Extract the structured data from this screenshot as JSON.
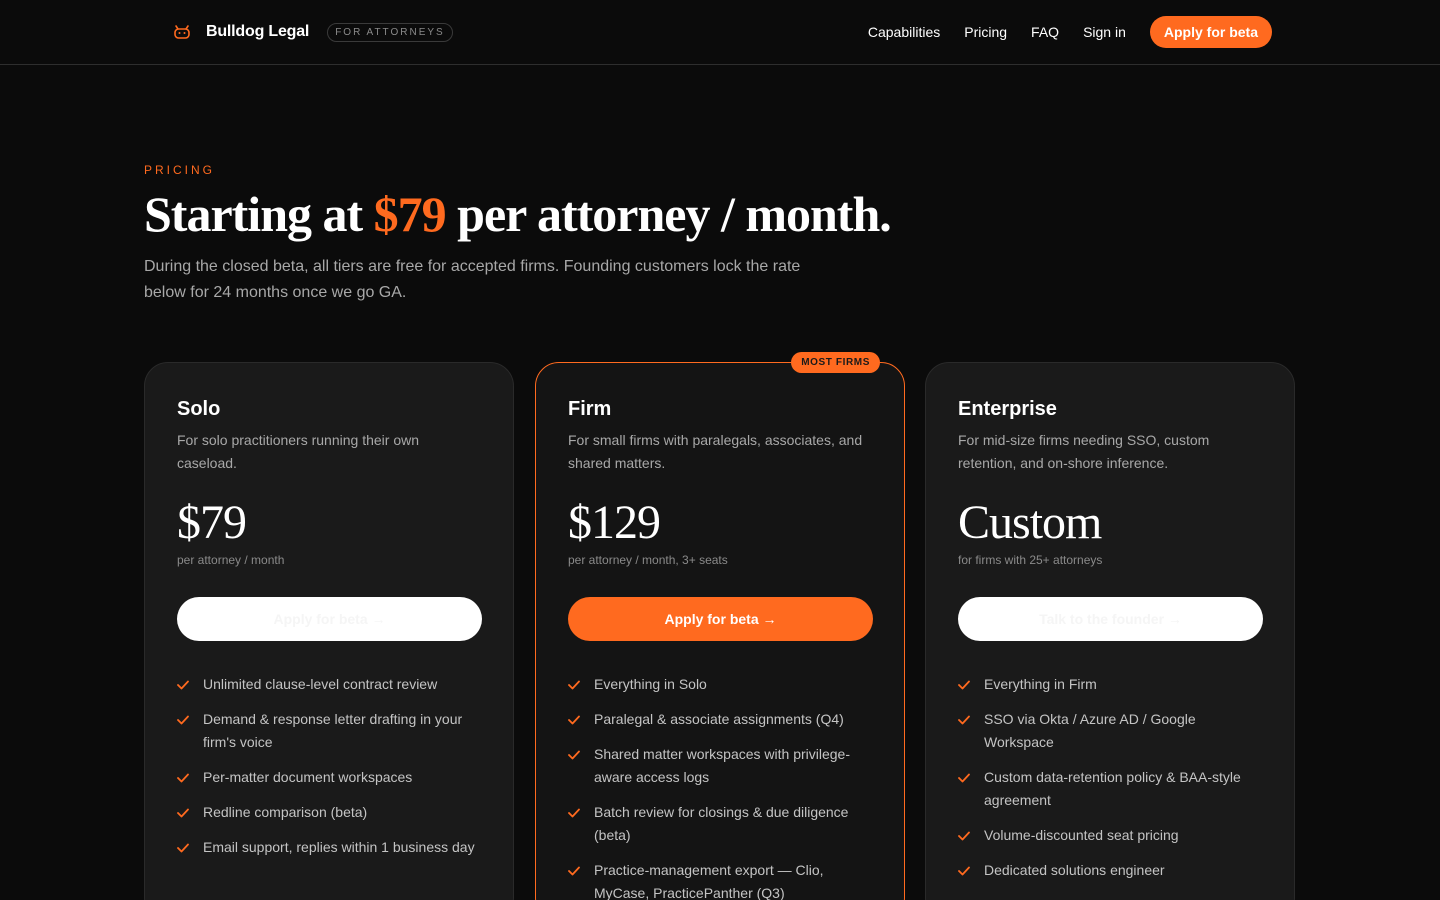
{
  "nav": {
    "brand_name": "Bulldog Legal",
    "brand_badge": "FOR ATTORNEYS",
    "links": [
      "Capabilities",
      "Pricing",
      "FAQ",
      "Sign in"
    ],
    "cta": "Apply for beta"
  },
  "hero": {
    "eyebrow": "PRICING",
    "headline_pre": "Starting at ",
    "headline_accent": "$79",
    "headline_post": " per attorney / month.",
    "subhead": "During the closed beta, all tiers are free for accepted firms. Founding customers lock the rate below for 24 months once we go GA."
  },
  "tiers": [
    {
      "name": "Solo",
      "desc": "For solo practitioners running their own caseload.",
      "price": "$79",
      "unit": "per attorney / month",
      "cta": "Apply for beta →",
      "features": [
        "Unlimited clause-level contract review",
        "Demand & response letter drafting in your firm's voice",
        "Per-matter document workspaces",
        "Redline comparison (beta)",
        "Email support, replies within 1 business day"
      ]
    },
    {
      "name": "Firm",
      "badge": "MOST FIRMS",
      "desc": "For small firms with paralegals, associates, and shared matters.",
      "price": "$129",
      "unit": "per attorney / month, 3+ seats",
      "cta": "Apply for beta →",
      "features": [
        "Everything in Solo",
        "Paralegal & associate assignments (Q4)",
        "Shared matter workspaces with privilege-aware access logs",
        "Batch review for closings & due diligence (beta)",
        "Practice-management export — Clio, MyCase, PracticePanther (Q3)"
      ]
    },
    {
      "name": "Enterprise",
      "desc": "For mid-size firms needing SSO, custom retention, and on-shore inference.",
      "price": "Custom",
      "unit": "for firms with 25+ attorneys",
      "cta": "Talk to the founder →",
      "features": [
        "Everything in Firm",
        "SSO via Okta / Azure AD / Google Workspace",
        "Custom data-retention policy & BAA-style agreement",
        "Volume-discounted seat pricing",
        "Dedicated solutions engineer"
      ]
    }
  ],
  "colors": {
    "accent": "#ff6a1f",
    "background": "#0b0b0b",
    "card": "#1a1a1a"
  },
  "icons": {
    "brand": "bulldog-icon",
    "feature": "check-icon"
  }
}
